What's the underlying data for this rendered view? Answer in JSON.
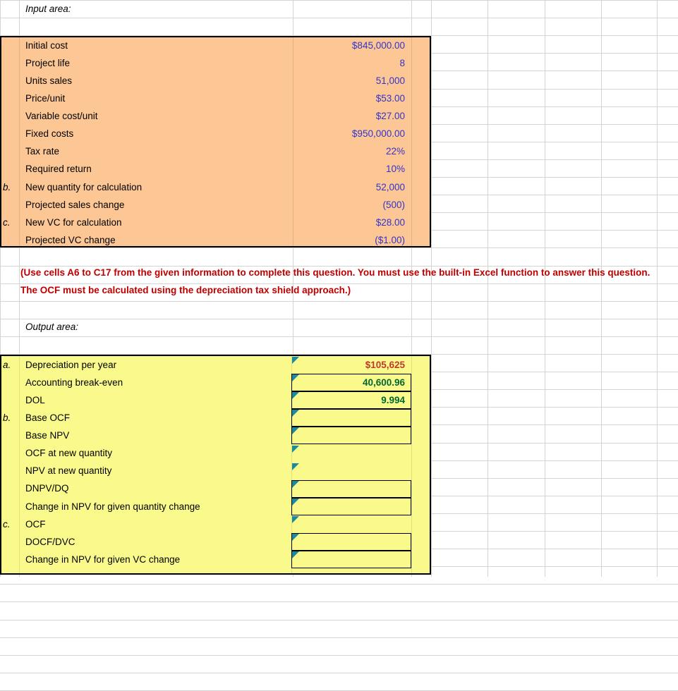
{
  "sheet": {
    "input_area_label": "Input area:",
    "output_area_label": "Output area:",
    "instruction": "(Use cells A6 to C17 from the given information to complete this question. You must use the built-in Excel function to answer this question. The OCF must be calculated using the depreciation tax shield approach.)",
    "colors": {
      "input_fill": "#fcc795",
      "output_fill": "#fafa8c",
      "input_value_text": "#3333cc",
      "instruction_text": "#c00000",
      "result_red_text": "#c0392b",
      "result_green_text": "#006633",
      "comment_marker": "#1a8a9e",
      "gridline": "#d4d4d4"
    }
  },
  "input_rows": [
    {
      "index": "",
      "label": "Initial cost",
      "value": "$845,000.00"
    },
    {
      "index": "",
      "label": "Project life",
      "value": "8"
    },
    {
      "index": "",
      "label": "Units sales",
      "value": "51,000"
    },
    {
      "index": "",
      "label": "Price/unit",
      "value": "$53.00"
    },
    {
      "index": "",
      "label": "Variable cost/unit",
      "value": "$27.00"
    },
    {
      "index": "",
      "label": "Fixed costs",
      "value": "$950,000.00"
    },
    {
      "index": "",
      "label": "Tax rate",
      "value": "22%"
    },
    {
      "index": "",
      "label": "Required return",
      "value": "10%"
    },
    {
      "index": "b.",
      "label": "New quantity for calculation",
      "value": "52,000"
    },
    {
      "index": "",
      "label": "Projected sales change",
      "value": "(500)"
    },
    {
      "index": "c.",
      "label": "New VC for calculation",
      "value": "$28.00"
    },
    {
      "index": "",
      "label": "Projected VC change",
      "value": "($1.00)"
    }
  ],
  "output_rows": [
    {
      "index": "a.",
      "label": "Depreciation per year",
      "value": "$105,625",
      "style": "red",
      "boxed": false,
      "comment": true
    },
    {
      "index": "",
      "label": "Accounting break-even",
      "value": "40,600.96",
      "style": "green",
      "boxed": true,
      "comment": true
    },
    {
      "index": "",
      "label": "DOL",
      "value": "9.994",
      "style": "green",
      "boxed": true,
      "comment": true
    },
    {
      "index": "b.",
      "label": "Base OCF",
      "value": "",
      "style": "green",
      "boxed": true,
      "comment": true
    },
    {
      "index": "",
      "label": "Base NPV",
      "value": "",
      "style": "green",
      "boxed": true,
      "comment": true
    },
    {
      "index": "",
      "label": "OCF at new quantity",
      "value": "",
      "style": "green",
      "boxed": false,
      "comment": true
    },
    {
      "index": "",
      "label": "NPV at new quantity",
      "value": "",
      "style": "green",
      "boxed": false,
      "comment": true
    },
    {
      "index": "",
      "label": "DNPV/DQ",
      "value": "",
      "style": "green",
      "boxed": true,
      "comment": true
    },
    {
      "index": "",
      "label": "Change in NPV for given quantity change",
      "value": "",
      "style": "green",
      "boxed": true,
      "comment": true
    },
    {
      "index": "c.",
      "label": "OCF",
      "value": "",
      "style": "green",
      "boxed": false,
      "comment": true
    },
    {
      "index": "",
      "label": "DOCF/DVC",
      "value": "",
      "style": "green",
      "boxed": true,
      "comment": true
    },
    {
      "index": "",
      "label": "Change in NPV for given VC change",
      "value": "",
      "style": "green",
      "boxed": true,
      "comment": true
    }
  ]
}
